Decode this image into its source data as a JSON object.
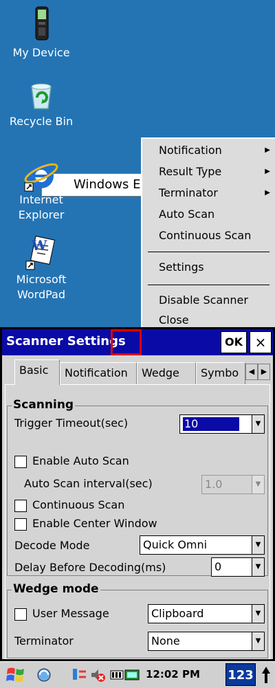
{
  "desktop": {
    "icons": [
      {
        "label_lines": [
          "My Device"
        ],
        "icon": "device-icon"
      },
      {
        "label_lines": [
          "Recycle Bin"
        ],
        "icon": "recycle-bin-icon"
      },
      {
        "label_lines": [
          "Internet",
          "Explorer"
        ],
        "icon": "internet-explorer-icon"
      },
      {
        "label_lines": [
          "Microsoft",
          "WordPad"
        ],
        "icon": "wordpad-icon"
      }
    ],
    "ie_window_text": "Windows E"
  },
  "context_menu": {
    "items": [
      {
        "label": "Notification",
        "submenu": true
      },
      {
        "label": "Result Type",
        "submenu": true
      },
      {
        "label": "Terminator",
        "submenu": true
      },
      {
        "label": "Auto Scan",
        "submenu": false
      },
      {
        "label": "Continuous Scan",
        "submenu": false
      },
      {
        "label": "Settings",
        "submenu": false
      },
      {
        "label": "Disable Scanner",
        "submenu": false
      },
      {
        "label": "Close",
        "submenu": false
      }
    ]
  },
  "dialog": {
    "title": "Scanner Settings",
    "ok_label": "OK",
    "close_label": "×",
    "tabs": [
      "Basic",
      "Notification",
      "Wedge",
      "Symbo"
    ],
    "active_tab": "Basic",
    "scanning": {
      "title": "Scanning",
      "trigger_timeout_label": "Trigger Timeout(sec)",
      "trigger_timeout_value": "10",
      "enable_auto_scan_label": "Enable Auto Scan",
      "enable_auto_scan_checked": false,
      "auto_scan_interval_label": "Auto Scan interval(sec)",
      "auto_scan_interval_value": "1.0",
      "continuous_scan_label": "Continuous Scan",
      "continuous_scan_checked": false,
      "enable_center_window_label": "Enable Center Window",
      "enable_center_window_checked": false,
      "decode_mode_label": "Decode Mode",
      "decode_mode_value": "Quick Omni",
      "delay_label": "Delay Before Decoding(ms)",
      "delay_value": "0"
    },
    "wedge": {
      "title": "Wedge mode",
      "user_message_label": "User Message",
      "user_message_checked": false,
      "user_message_value": "Clipboard",
      "terminator_label": "Terminator",
      "terminator_value": "None"
    }
  },
  "taskbar": {
    "time": "12:02 PM",
    "input_panel_label": "123"
  },
  "colors": {
    "desktop_bg": "#2474b4",
    "titlebar": "#0a0aa6",
    "highlight_box": "#e00000"
  }
}
